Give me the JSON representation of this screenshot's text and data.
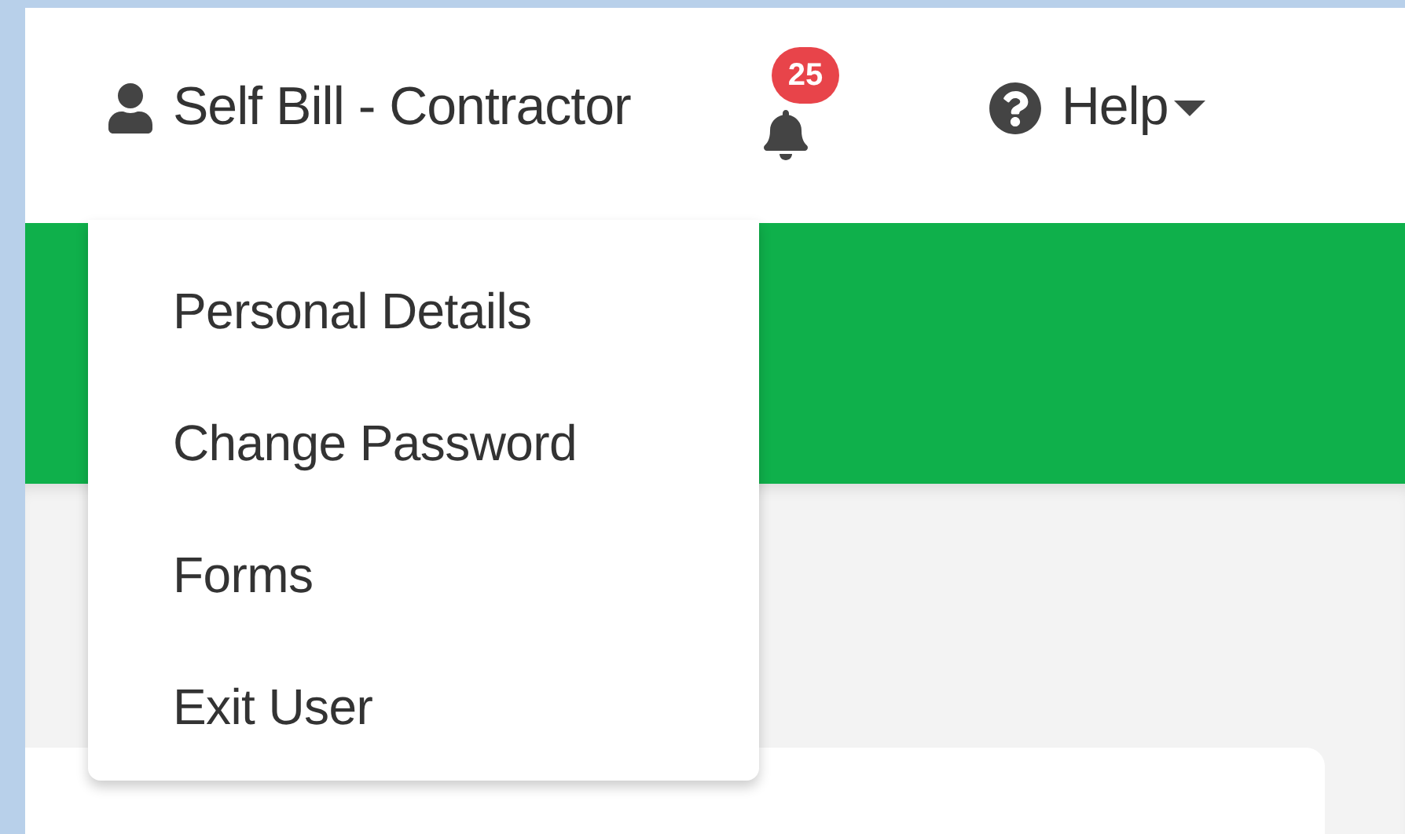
{
  "navbar": {
    "user_menu": {
      "label": "Self Bill - Contractor",
      "expanded": true
    },
    "notifications": {
      "count": "25"
    },
    "help": {
      "label": "Help"
    }
  },
  "user_dropdown": [
    "Personal Details",
    "Change Password",
    "Forms",
    "Exit User"
  ]
}
